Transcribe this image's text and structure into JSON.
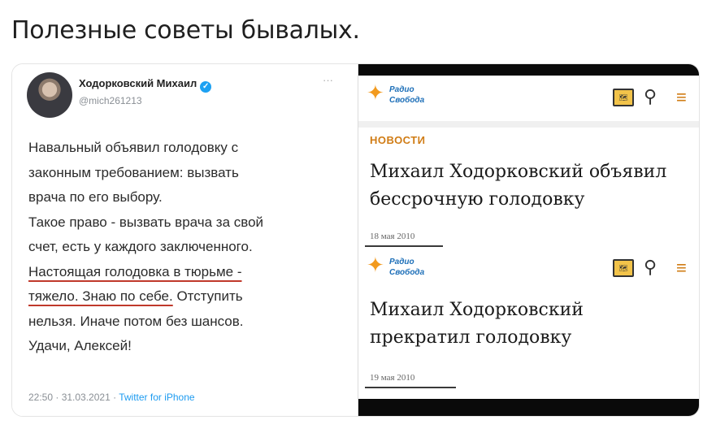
{
  "caption": "Полезные советы бывалых.",
  "tweet": {
    "author": "Ходорковский Михаил",
    "verified_mark": "✓",
    "handle": "@mich261213",
    "more": "···",
    "lines": [
      "Навальный объявил голодовку с",
      "законным требованием: вызвать",
      "врача по его выбору.",
      "Такое право - вызвать врача за свой",
      "счет, есть у каждого заключенного.",
      "Настоящая голодовка в тюрьме -",
      "тяжело. Знаю по себе.",
      " Отступить",
      "нельзя. Иначе потом без шансов.",
      "Удачи, Алексей!"
    ],
    "time": "22:50 · 31.03.2021 · ",
    "source": "Twitter for iPhone"
  },
  "articles": [
    {
      "logo_line1": "Радио",
      "logo_line2": "Свобода",
      "section": "НОВОСТИ",
      "headline_line1": "Михаил Ходорковский объявил",
      "headline_line2": "бессрочную голодовку",
      "date": "18 мая 2010"
    },
    {
      "logo_line1": "Радио",
      "logo_line2": "Свобода",
      "headline_line1": "Михаил Ходорковский",
      "headline_line2": "прекратил голодовку",
      "date": "19 мая 2010"
    }
  ],
  "icons": {
    "logo": "radio-svoboda-logo-icon",
    "book": "book-map-icon",
    "search": "search-icon",
    "menu": "menu-icon"
  },
  "colors": {
    "accent_orange": "#d07c15",
    "link_blue": "#1d9bf0",
    "underline_red": "#c0392b"
  }
}
